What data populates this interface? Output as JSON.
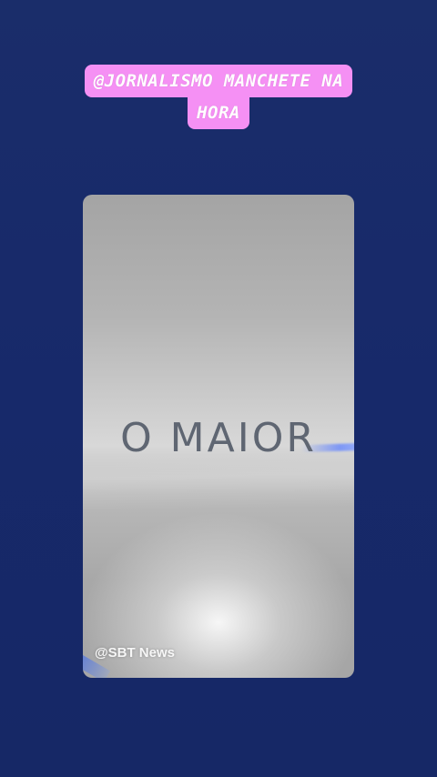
{
  "story": {
    "caption_lines": [
      "@JORNALISMO MANCHETE NA",
      "HORA"
    ],
    "caption_color": "#f590f4",
    "background_color": "#1a2d6a"
  },
  "video": {
    "headline": "O MAIOR",
    "watermark": "@SBT News"
  }
}
